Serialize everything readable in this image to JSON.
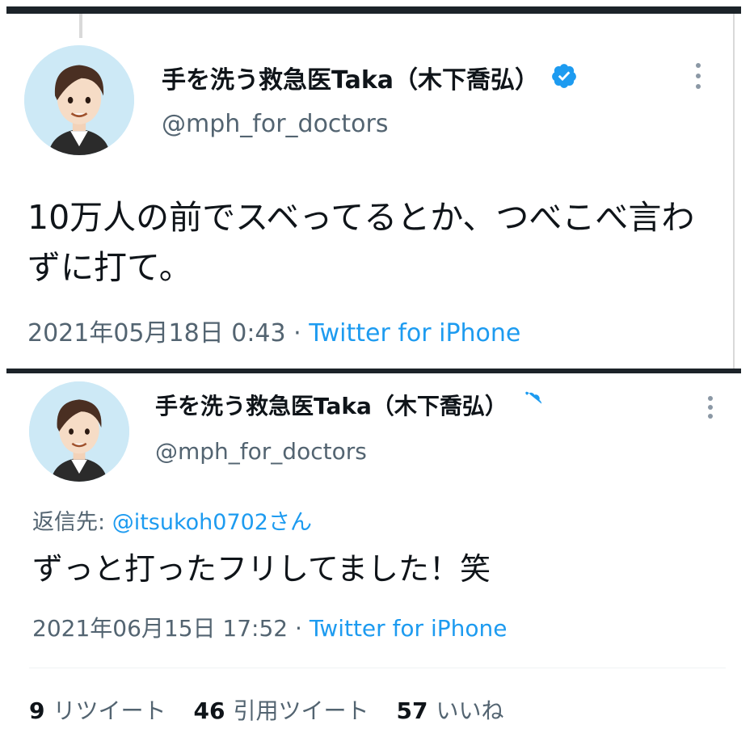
{
  "tweets": [
    {
      "display_name": "手を洗う救急医Taka（木下喬弘）",
      "handle": "@mph_for_doctors",
      "text": "10万人の前でスベってるとか、つべこべ言わずに打て。",
      "timestamp": "2021年05月18日 0:43",
      "separator": "·",
      "source": "Twitter for iPhone"
    },
    {
      "display_name": "手を洗う救急医Taka（木下喬弘）",
      "handle": "@mph_for_doctors",
      "reply_prefix": "返信先:",
      "reply_mention": "@itsukoh0702さん",
      "text": "ずっと打ったフリしてました！笑",
      "timestamp": "2021年06月15日 17:52",
      "separator": "·",
      "source": "Twitter for iPhone"
    }
  ],
  "stats": {
    "retweets_count": "9",
    "retweets_label": "リツイート",
    "quotes_count": "46",
    "quotes_label": "引用ツイート",
    "likes_count": "57",
    "likes_label": "いいね"
  },
  "colors": {
    "text": "#0f1419",
    "secondary": "#536471",
    "link": "#1d9bf0",
    "verified": "#1d9bf0",
    "separator_bar": "#1c2329"
  },
  "icons": {
    "verified": "verified-badge-icon",
    "more": "more-vertical-icon"
  }
}
